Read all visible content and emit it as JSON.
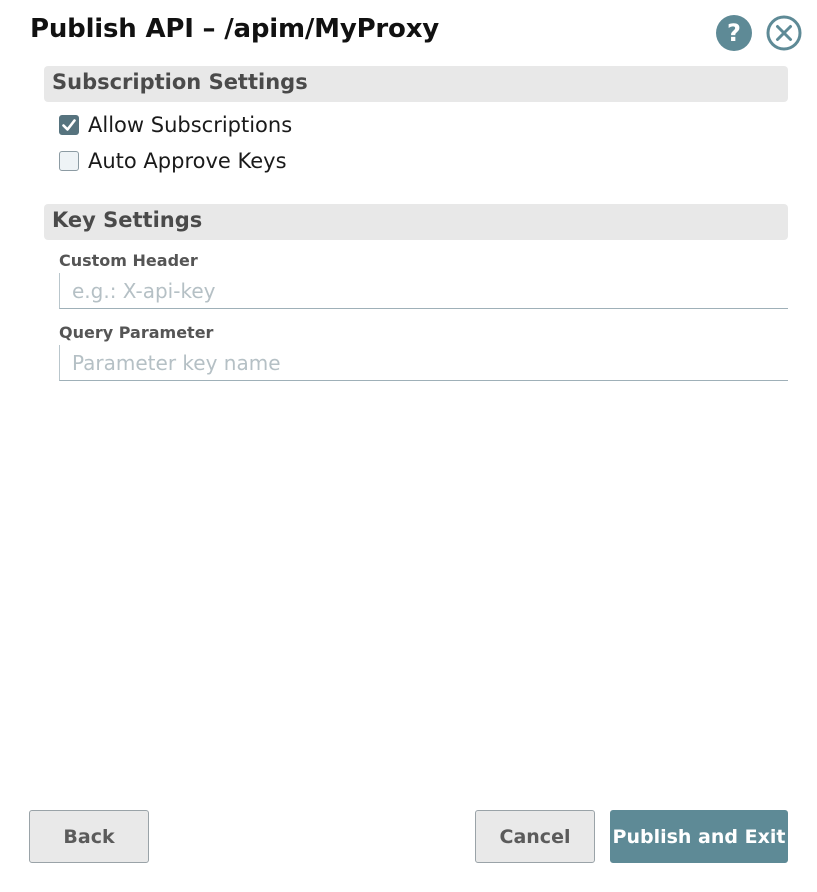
{
  "dialog": {
    "title": "Publish API – /apim/MyProxy",
    "help_icon": "?"
  },
  "subscription_settings": {
    "title": "Subscription Settings",
    "allow_subscriptions": {
      "label": "Allow Subscriptions",
      "checked": true
    },
    "auto_approve_keys": {
      "label": "Auto Approve Keys",
      "checked": false
    }
  },
  "key_settings": {
    "title": "Key Settings",
    "custom_header": {
      "label": "Custom Header",
      "value": "",
      "placeholder": "e.g.: X-api-key"
    },
    "query_parameter": {
      "label": "Query Parameter",
      "value": "",
      "placeholder": "Parameter key name"
    }
  },
  "footer": {
    "back_label": "Back",
    "cancel_label": "Cancel",
    "publish_label": "Publish and Exit"
  },
  "colors": {
    "accent": "#5e8a96",
    "checkbox_checked": "#56737e",
    "section_header_bg": "#e8e8e8"
  },
  "icons": {
    "help": "help-icon",
    "close": "close-icon",
    "checkmark": "checkmark-icon"
  }
}
